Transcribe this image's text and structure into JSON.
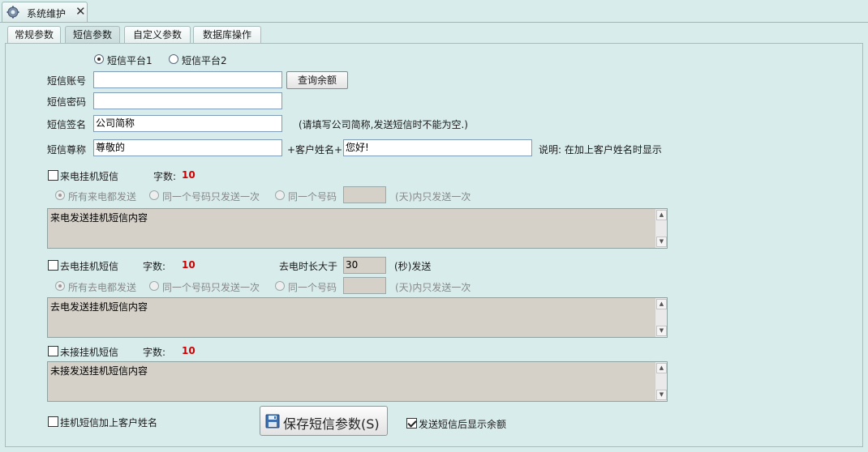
{
  "window_tab": {
    "title": "系统维护",
    "icon": "gear-icon",
    "close": "✕"
  },
  "tabs": [
    "常规参数",
    "短信参数",
    "自定义参数",
    "数据库操作"
  ],
  "platform": {
    "option1": "短信平台1",
    "option2": "短信平台2",
    "selected": 1
  },
  "account": {
    "label": "短信账号",
    "value": "",
    "button": "查询余额"
  },
  "password": {
    "label": "短信密码",
    "value": ""
  },
  "signature": {
    "label": "短信签名",
    "value": "公司简称",
    "hint": "(请填写公司简称,发送短信时不能为空.)"
  },
  "salutation": {
    "label": "短信尊称",
    "value": "尊敬的",
    "plus_name": "+客户姓名+",
    "greeting": "您好!",
    "note": "说明: 在加上客户姓名时显示"
  },
  "incoming": {
    "checkbox_label": "来电挂机短信",
    "checked": false,
    "count_label": "字数:",
    "count": "10",
    "opt_all": "所有来电都发送",
    "opt_once": "同一个号码只发送一次",
    "opt_same": "同一个号码",
    "days_value": "",
    "days_suffix": "(天)内只发送一次",
    "content": "来电发送挂机短信内容"
  },
  "outgoing": {
    "checkbox_label": "去电挂机短信",
    "checked": false,
    "count_label": "字数:",
    "count": "10",
    "duration_label": "去电时长大于",
    "duration_value": "30",
    "duration_suffix": "(秒)发送",
    "opt_all": "所有去电都发送",
    "opt_once": "同一个号码只发送一次",
    "opt_same": "同一个号码",
    "days_value": "",
    "days_suffix": "(天)内只发送一次",
    "content": "去电发送挂机短信内容"
  },
  "missed": {
    "checkbox_label": "未接挂机短信",
    "checked": false,
    "count_label": "字数:",
    "count": "10",
    "content": "未接发送挂机短信内容"
  },
  "footer": {
    "add_name_label": "挂机短信加上客户姓名",
    "add_name_checked": false,
    "save_button": "保存短信参数(S)",
    "show_balance_label": "发送短信后显示余额",
    "show_balance_checked": true
  },
  "colors": {
    "background": "#d9ecec",
    "count_red": "#cc0000",
    "disabled_field": "#d5d1c9"
  }
}
